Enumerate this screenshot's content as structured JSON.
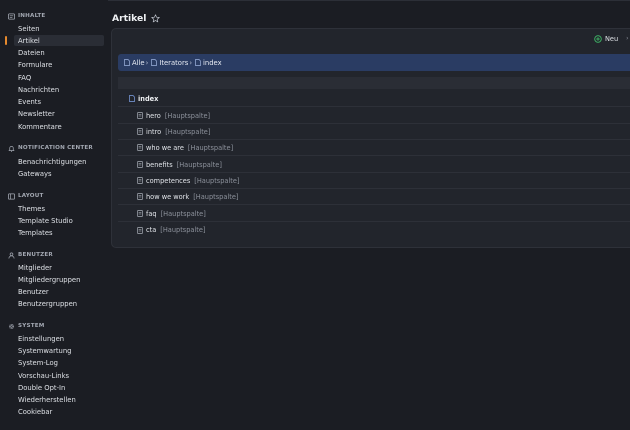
{
  "sidebar": {
    "sections": [
      {
        "title": "INHALTE",
        "icon": "content-icon",
        "items": [
          "Seiten",
          "Artikel",
          "Dateien",
          "Formulare",
          "FAQ",
          "Nachrichten",
          "Events",
          "Newsletter",
          "Kommentare"
        ]
      },
      {
        "title": "NOTIFICATION CENTER",
        "icon": "bell-icon",
        "items": [
          "Benachrichtigungen",
          "Gateways"
        ]
      },
      {
        "title": "LAYOUT",
        "icon": "layout-icon",
        "items": [
          "Themes",
          "Template Studio",
          "Templates"
        ]
      },
      {
        "title": "BENUTZER",
        "icon": "user-icon",
        "items": [
          "Mitglieder",
          "Mitgliedergruppen",
          "Benutzer",
          "Benutzergruppen"
        ]
      },
      {
        "title": "SYSTEM",
        "icon": "gear-icon",
        "items": [
          "Einstellungen",
          "Systemwartung",
          "System-Log",
          "Vorschau-Links",
          "Double Opt-In",
          "Wiederherstellen",
          "Cookiebar"
        ]
      }
    ],
    "active_item": "Artikel"
  },
  "header": {
    "title": "Artikel",
    "star_icon": "star-outline-icon"
  },
  "toolbar": {
    "new_label": "Neu",
    "accent_color": "#3fb968"
  },
  "breadcrumb": [
    "Alle",
    "Iterators",
    "index"
  ],
  "tree": {
    "root": "index",
    "children": [
      {
        "name": "hero",
        "column": "[Hauptspalte]"
      },
      {
        "name": "intro",
        "column": "[Hauptspalte]"
      },
      {
        "name": "who we are",
        "column": "[Hauptspalte]"
      },
      {
        "name": "benefits",
        "column": "[Hauptspalte]"
      },
      {
        "name": "competences",
        "column": "[Hauptspalte]"
      },
      {
        "name": "how we work",
        "column": "[Hauptspalte]"
      },
      {
        "name": "faq",
        "column": "[Hauptspalte]"
      },
      {
        "name": "cta",
        "column": "[Hauptspalte]"
      }
    ]
  },
  "colors": {
    "background": "#1b1d23",
    "active_marker": "#e68a2e",
    "breadcrumb_bg": "#2a3c63"
  }
}
